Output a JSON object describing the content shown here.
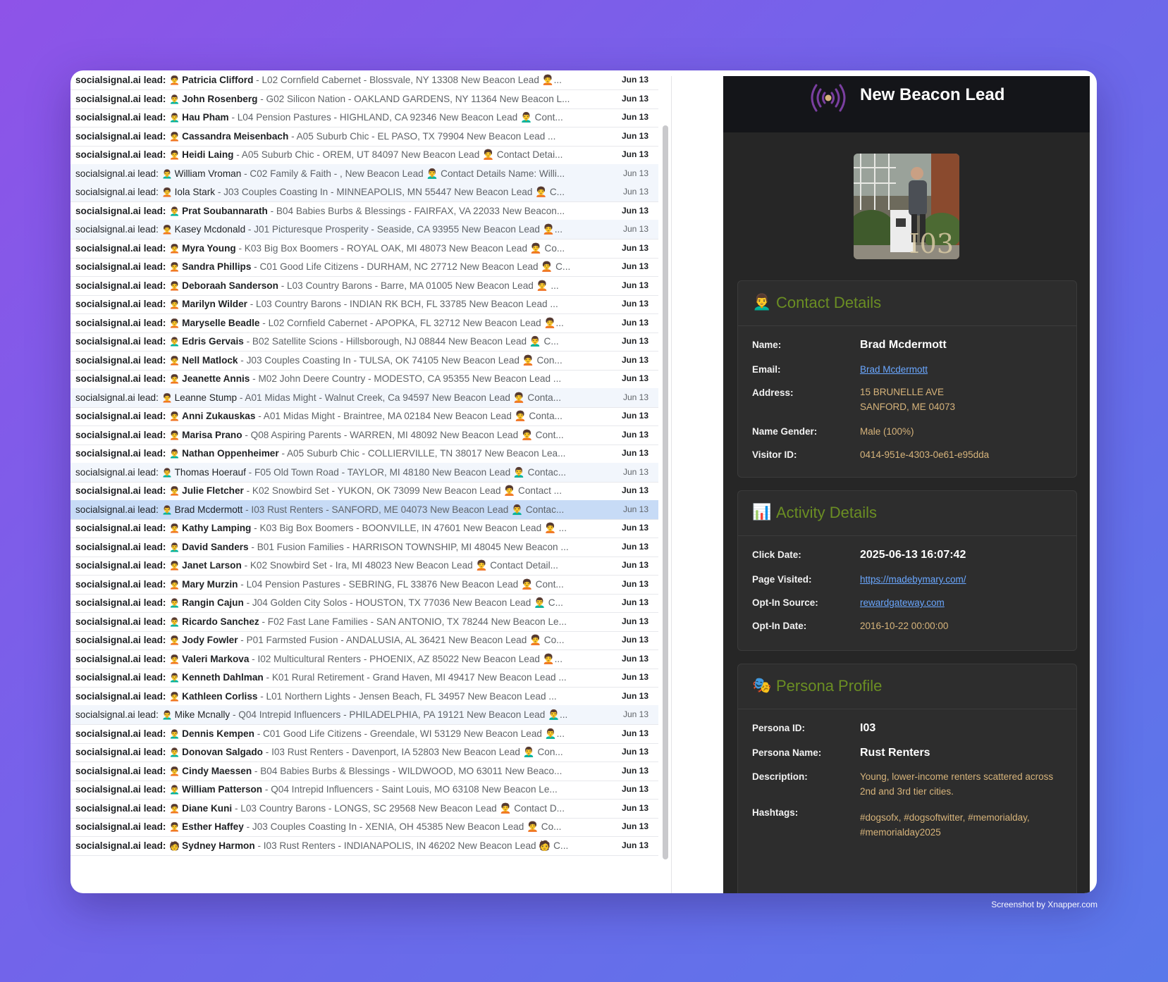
{
  "mail_list": {
    "sender": "socialsignal.ai lead:",
    "rows": [
      {
        "name": "Patricia Clifford",
        "emoji": "🧑‍🦱",
        "snippet": "- L02 Cornfield Cabernet - Blossvale, NY 13308 New Beacon Lead 🧑‍🦱...",
        "date": "Jun 13",
        "read": false
      },
      {
        "name": "John Rosenberg",
        "emoji": "👨‍🦱",
        "snippet": "- G02 Silicon Nation - OAKLAND GARDENS, NY 11364 New Beacon L...",
        "date": "Jun 13",
        "read": false
      },
      {
        "name": "Hau Pham",
        "emoji": "👨‍🦱",
        "snippet": "- L04 Pension Pastures - HIGHLAND, CA 92346 New Beacon Lead 👨‍🦱 Cont...",
        "date": "Jun 13",
        "read": false
      },
      {
        "name": "Cassandra Meisenbach",
        "emoji": "🧑‍🦱",
        "snippet": "- A05 Suburb Chic - EL PASO, TX 79904 New Beacon Lead ...",
        "date": "Jun 13",
        "read": false
      },
      {
        "name": "Heidi Laing",
        "emoji": "🧑‍🦱",
        "snippet": "- A05 Suburb Chic - OREM, UT 84097 New Beacon Lead 🧑‍🦱 Contact Detai...",
        "date": "Jun 13",
        "read": false
      },
      {
        "name": "William Vroman",
        "emoji": "👨‍🦱",
        "snippet": "- C02 Family & Faith - , New Beacon Lead 👨‍🦱 Contact Details Name: Willi...",
        "date": "Jun 13",
        "read": true
      },
      {
        "name": "Iola Stark",
        "emoji": "🧑‍🦱",
        "snippet": "- J03 Couples Coasting In - MINNEAPOLIS, MN 55447 New Beacon Lead 🧑‍🦱 C...",
        "date": "Jun 13",
        "read": true
      },
      {
        "name": "Prat Soubannarath",
        "emoji": "👨‍🦱",
        "snippet": "- B04 Babies Burbs & Blessings - FAIRFAX, VA 22033 New Beacon...",
        "date": "Jun 13",
        "read": false
      },
      {
        "name": "Kasey Mcdonald",
        "emoji": "🧑‍🦱",
        "snippet": "- J01 Picturesque Prosperity - Seaside, CA 93955 New Beacon Lead 🧑‍🦱...",
        "date": "Jun 13",
        "read": true
      },
      {
        "name": "Myra Young",
        "emoji": "🧑‍🦱",
        "snippet": "- K03 Big Box Boomers - ROYAL OAK, MI 48073 New Beacon Lead 🧑‍🦱 Co...",
        "date": "Jun 13",
        "read": false
      },
      {
        "name": "Sandra Phillips",
        "emoji": "🧑‍🦱",
        "snippet": "- C01 Good Life Citizens - DURHAM, NC 27712 New Beacon Lead 🧑‍🦱 C...",
        "date": "Jun 13",
        "read": false
      },
      {
        "name": "Deboraah Sanderson",
        "emoji": "🧑‍🦱",
        "snippet": "- L03 Country Barons - Barre, MA 01005 New Beacon Lead 🧑‍🦱 ...",
        "date": "Jun 13",
        "read": false
      },
      {
        "name": "Marilyn Wilder",
        "emoji": "🧑‍🦱",
        "snippet": "- L03 Country Barons - INDIAN RK BCH, FL 33785 New Beacon Lead ...",
        "date": "Jun 13",
        "read": false
      },
      {
        "name": "Maryselle Beadle",
        "emoji": "🧑‍🦱",
        "snippet": "- L02 Cornfield Cabernet - APOPKA, FL 32712 New Beacon Lead 🧑‍🦱...",
        "date": "Jun 13",
        "read": false
      },
      {
        "name": "Edris Gervais",
        "emoji": "👨‍🦱",
        "snippet": "- B02 Satellite Scions - Hillsborough, NJ 08844 New Beacon Lead 👨‍🦱 C...",
        "date": "Jun 13",
        "read": false
      },
      {
        "name": "Nell Matlock",
        "emoji": "🧑‍🦱",
        "snippet": "- J03 Couples Coasting In - TULSA, OK 74105 New Beacon Lead 🧑‍🦱 Con...",
        "date": "Jun 13",
        "read": false
      },
      {
        "name": "Jeanette Annis",
        "emoji": "🧑‍🦱",
        "snippet": "- M02 John Deere Country - MODESTO, CA 95355 New Beacon Lead ...",
        "date": "Jun 13",
        "read": false
      },
      {
        "name": "Leanne Stump",
        "emoji": "🧑‍🦱",
        "snippet": "- A01 Midas Might - Walnut Creek, Ca 94597 New Beacon Lead 🧑‍🦱 Conta...",
        "date": "Jun 13",
        "read": true
      },
      {
        "name": "Anni Zukauskas",
        "emoji": "🧑‍🦱",
        "snippet": "- A01 Midas Might - Braintree, MA 02184 New Beacon Lead 🧑‍🦱 Conta...",
        "date": "Jun 13",
        "read": false
      },
      {
        "name": "Marisa Prano",
        "emoji": "🧑‍🦱",
        "snippet": "- Q08 Aspiring Parents - WARREN, MI 48092 New Beacon Lead 🧑‍🦱 Cont...",
        "date": "Jun 13",
        "read": false
      },
      {
        "name": "Nathan Oppenheimer",
        "emoji": "👨‍🦱",
        "snippet": "- A05 Suburb Chic - COLLIERVILLE, TN 38017 New Beacon Lea...",
        "date": "Jun 13",
        "read": false
      },
      {
        "name": "Thomas Hoerauf",
        "emoji": "👨‍🦱",
        "snippet": "- F05 Old Town Road - TAYLOR, MI 48180 New Beacon Lead 👨‍🦱 Contac...",
        "date": "Jun 13",
        "read": true
      },
      {
        "name": "Julie Fletcher",
        "emoji": "🧑‍🦱",
        "snippet": "- K02 Snowbird Set - YUKON, OK 73099 New Beacon Lead 🧑‍🦱 Contact ...",
        "date": "Jun 13",
        "read": false
      },
      {
        "name": "Brad Mcdermott",
        "emoji": "👨‍🦱",
        "snippet": "- I03 Rust Renters - SANFORD, ME 04073 New Beacon Lead 👨‍🦱 Contac...",
        "date": "Jun 13",
        "read": true,
        "selected": true
      },
      {
        "name": "Kathy Lamping",
        "emoji": "🧑‍🦱",
        "snippet": "- K03 Big Box Boomers - BOONVILLE, IN 47601 New Beacon Lead 🧑‍🦱 ...",
        "date": "Jun 13",
        "read": false
      },
      {
        "name": "David Sanders",
        "emoji": "👨‍🦱",
        "snippet": "- B01 Fusion Families - HARRISON TOWNSHIP, MI 48045 New Beacon ...",
        "date": "Jun 13",
        "read": false
      },
      {
        "name": "Janet Larson",
        "emoji": "🧑‍🦱",
        "snippet": "- K02 Snowbird Set - Ira, MI 48023 New Beacon Lead 🧑‍🦱 Contact Detail...",
        "date": "Jun 13",
        "read": false
      },
      {
        "name": "Mary Murzin",
        "emoji": "🧑‍🦱",
        "snippet": "- L04 Pension Pastures - SEBRING, FL 33876 New Beacon Lead 🧑‍🦱 Cont...",
        "date": "Jun 13",
        "read": false
      },
      {
        "name": "Rangin Cajun",
        "emoji": "👨‍🦱",
        "snippet": "- J04 Golden City Solos - HOUSTON, TX 77036 New Beacon Lead 👨‍🦱 C...",
        "date": "Jun 13",
        "read": false
      },
      {
        "name": "Ricardo Sanchez",
        "emoji": "👨‍🦱",
        "snippet": "- F02 Fast Lane Families - SAN ANTONIO, TX 78244 New Beacon Le...",
        "date": "Jun 13",
        "read": false
      },
      {
        "name": "Jody Fowler",
        "emoji": "🧑‍🦱",
        "snippet": "- P01 Farmsted Fusion - ANDALUSIA, AL 36421 New Beacon Lead 🧑‍🦱 Co...",
        "date": "Jun 13",
        "read": false
      },
      {
        "name": "Valeri Markova",
        "emoji": "🧑‍🦱",
        "snippet": "- I02 Multicultural Renters - PHOENIX, AZ 85022 New Beacon Lead 🧑‍🦱...",
        "date": "Jun 13",
        "read": false
      },
      {
        "name": "Kenneth Dahlman",
        "emoji": "👨‍🦱",
        "snippet": "- K01 Rural Retirement - Grand Haven, MI 49417 New Beacon Lead ...",
        "date": "Jun 13",
        "read": false
      },
      {
        "name": "Kathleen Corliss",
        "emoji": "🧑‍🦱",
        "snippet": "- L01 Northern Lights - Jensen Beach, FL 34957 New Beacon Lead ...",
        "date": "Jun 13",
        "read": false
      },
      {
        "name": "Mike Mcnally",
        "emoji": "👨‍🦱",
        "snippet": "- Q04 Intrepid Influencers - PHILADELPHIA, PA 19121 New Beacon Lead 👨‍🦱...",
        "date": "Jun 13",
        "read": true
      },
      {
        "name": "Dennis Kempen",
        "emoji": "👨‍🦱",
        "snippet": "- C01 Good Life Citizens - Greendale, WI 53129 New Beacon Lead 👨‍🦱...",
        "date": "Jun 13",
        "read": false
      },
      {
        "name": "Donovan Salgado",
        "emoji": "👨‍🦱",
        "snippet": "- I03 Rust Renters - Davenport, IA 52803 New Beacon Lead 👨‍🦱 Con...",
        "date": "Jun 13",
        "read": false
      },
      {
        "name": "Cindy Maessen",
        "emoji": "🧑‍🦱",
        "snippet": "- B04 Babies Burbs & Blessings - WILDWOOD, MO 63011 New Beaco...",
        "date": "Jun 13",
        "read": false
      },
      {
        "name": "William Patterson",
        "emoji": "👨‍🦱",
        "snippet": "- Q04 Intrepid Influencers - Saint Louis, MO 63108 New Beacon Le...",
        "date": "Jun 13",
        "read": false
      },
      {
        "name": "Diane Kuni",
        "emoji": "🧑‍🦱",
        "snippet": "- L03 Country Barons - LONGS, SC 29568 New Beacon Lead 🧑‍🦱 Contact D...",
        "date": "Jun 13",
        "read": false
      },
      {
        "name": "Esther Haffey",
        "emoji": "🧑‍🦱",
        "snippet": "- J03 Couples Coasting In - XENIA, OH 45385 New Beacon Lead 🧑‍🦱 Co...",
        "date": "Jun 13",
        "read": false
      },
      {
        "name": "Sydney Harmon",
        "emoji": "🧑",
        "snippet": "- I03 Rust Renters - INDIANAPOLIS, IN 46202 New Beacon Lead 🧑 C...",
        "date": "Jun 13",
        "read": false
      }
    ]
  },
  "email": {
    "title": "New Beacon Lead",
    "image_label": "I03",
    "contact": {
      "icon": "👨‍🦱",
      "title": "Contact Details",
      "name_label": "Name:",
      "name": "Brad Mcdermott",
      "email_label": "Email:",
      "email": "Brad Mcdermott",
      "address_label": "Address:",
      "address_line1": "15 BRUNELLE AVE",
      "address_line2": "SANFORD, ME 04073",
      "gender_label": "Name Gender:",
      "gender": "Male (100%)",
      "visitor_label": "Visitor ID:",
      "visitor_id": "0414-951e-4303-0e61-e95dda"
    },
    "activity": {
      "icon": "📊",
      "title": "Activity Details",
      "click_label": "Click Date:",
      "click_date": "2025-06-13 16:07:42",
      "page_label": "Page Visited:",
      "page": "https://madebymary.com/",
      "source_label": "Opt-In Source:",
      "source": "rewardgateway.com",
      "optin_label": "Opt-In Date:",
      "optin_date": "2016-10-22 00:00:00"
    },
    "persona": {
      "icon": "🎭",
      "title": "Persona Profile",
      "id_label": "Persona ID:",
      "id": "I03",
      "name_label": "Persona Name:",
      "name": "Rust Renters",
      "desc_label": "Description:",
      "desc": "Young, lower-income renters scattered across 2nd and 3rd tier cities.",
      "tags_label": "Hashtags:",
      "tags": "#dogsofx, #dogsoftwitter, #memorialday, #memorialday2025"
    }
  },
  "footer": {
    "credit": "Screenshot by Xnapper.com"
  },
  "colors": {
    "accent_green": "#6b8e23",
    "value_gold": "#d7b47b",
    "link_blue": "#6aa7ff",
    "beacon_purple": "#7a3fa0"
  }
}
